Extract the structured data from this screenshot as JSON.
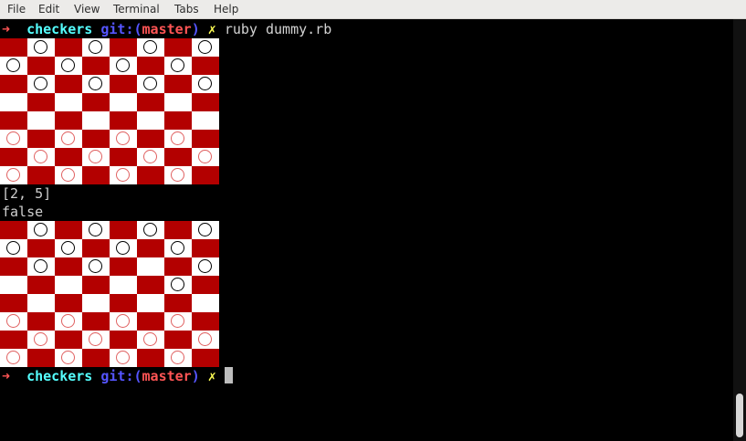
{
  "menubar": {
    "items": [
      "File",
      "Edit",
      "View",
      "Terminal",
      "Tabs",
      "Help"
    ]
  },
  "prompt": {
    "arrow": "➜",
    "directory": "checkers",
    "git_label": "git:(",
    "branch": "master",
    "git_close": ")",
    "status_mark": "✗"
  },
  "command": "ruby dummy.rb",
  "output": {
    "position": "[2, 5]",
    "result": "false"
  },
  "colors": {
    "dark_square": "#b30000",
    "light_square": "#ffffff",
    "black_piece": "#000000",
    "red_piece": "#e06060",
    "prompt_arrow": "#ff5555",
    "prompt_dir": "#55ffff",
    "prompt_git": "#5555ff",
    "prompt_branch": "#ff5555",
    "prompt_mark": "#ffff55"
  },
  "boards": [
    {
      "rows": [
        ". b . b . b . b",
        "b . b . b . b .",
        ". b . b . b . b",
        ". . . . . . . .",
        ". . . . . . . .",
        "r . r . r . r .",
        ". r . r . r . r",
        "r . r . r . r ."
      ]
    },
    {
      "rows": [
        ". b . b . b . b",
        "b . b . b . b .",
        ". b . b . . . b",
        ". . . . . . b .",
        ". . . . . . . .",
        "r . r . r . r .",
        ". r . r . r . r",
        "r . r . r . r ."
      ]
    }
  ]
}
